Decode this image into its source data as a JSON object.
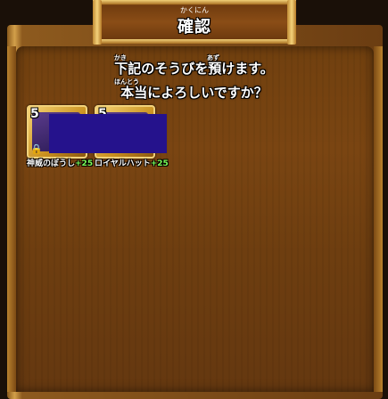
{
  "header": {
    "title_ruby": "かくにん",
    "title": "確認"
  },
  "message": {
    "line1": "下記のそうびを預けます。",
    "line1_ruby_a": "かき",
    "line1_ruby_b": "あず",
    "line2": "本当によろしいですか？",
    "line2_ruby": "ほんとう"
  },
  "items": [
    {
      "level": "5",
      "name": "神威のぼうし",
      "plus": "+25",
      "icon": "helmet-icon",
      "locked": true
    },
    {
      "level": "5",
      "name": "ロイヤルハット",
      "plus": "+25",
      "icon": "hat-icon",
      "locked": false
    }
  ],
  "colors": {
    "wood_dark": "#6e3e10",
    "gold": "#e1b45a",
    "plus_green": "#7cff58",
    "censor": "#25128c"
  }
}
